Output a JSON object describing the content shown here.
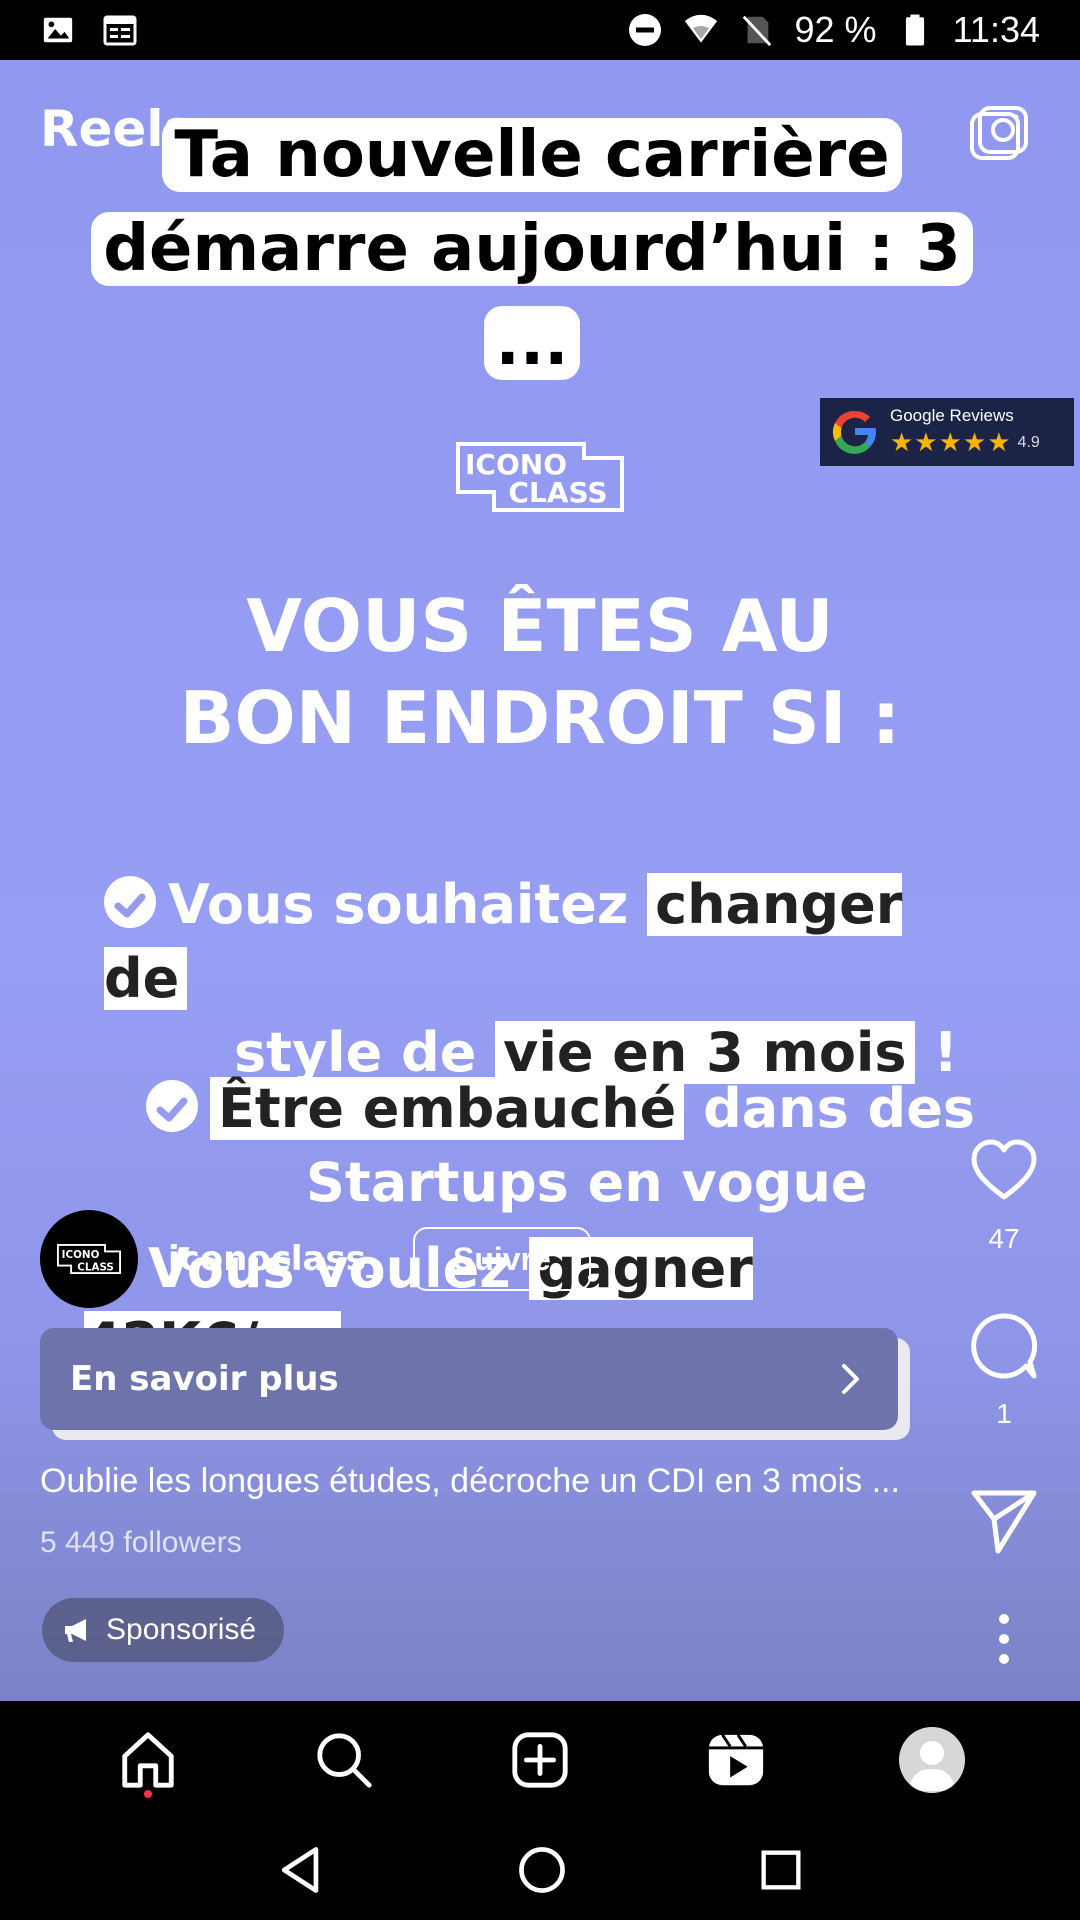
{
  "status_bar": {
    "battery_percent": "92 %",
    "time": "11:34"
  },
  "reel": {
    "title": "Reels",
    "caption_line1": "Ta nouvelle carrière",
    "caption_line2": "démarre aujourd’hui : 3 ...",
    "google_reviews": {
      "label": "Google Reviews",
      "stars": "★★★★★",
      "score": "4.9"
    },
    "logo_text_1": "ICONO",
    "logo_text_2": "CLASS",
    "headline_line1": "VOUS ÊTES AU",
    "headline_line2": "BON ENDROIT SI :",
    "bullet1_a": "Vous souhaitez ",
    "bullet1_hl1": "changer de",
    "bullet1_b": "style de ",
    "bullet1_hl2": "vie en 3 mois",
    "bullet1_c": " !",
    "bullet2_hl": "Être embauché",
    "bullet2_a": " dans des",
    "bullet2_b": "Startups en vogue",
    "bullet3_a": "Vous voulez ",
    "bullet3_hl": "gagner 42K€/an"
  },
  "post": {
    "username": "iconoclass_",
    "follow_label": "Suivre",
    "cta_label": "En savoir plus",
    "description": "Oublie les longues études, décroche un CDI en 3 mois ...",
    "followers": "5 449 followers",
    "sponsored_label": "Sponsorisé"
  },
  "actions": {
    "like_count": "47",
    "comment_count": "1"
  },
  "colors": {
    "reel_bg": "#979ff5",
    "cta_bg": "#6e74ab",
    "notification_dot": "#ff3040",
    "stars": "#f4b400"
  },
  "icons": {
    "status_left": [
      "image-icon",
      "calendar-icon"
    ],
    "status_right": [
      "dnd-icon",
      "wifi-icon",
      "no-sim-icon",
      "battery-icon"
    ],
    "bottom_nav": [
      "home-icon",
      "search-icon",
      "create-icon",
      "reels-icon",
      "profile-avatar"
    ],
    "system_nav": [
      "back-icon",
      "home-circle-icon",
      "recents-icon"
    ]
  }
}
